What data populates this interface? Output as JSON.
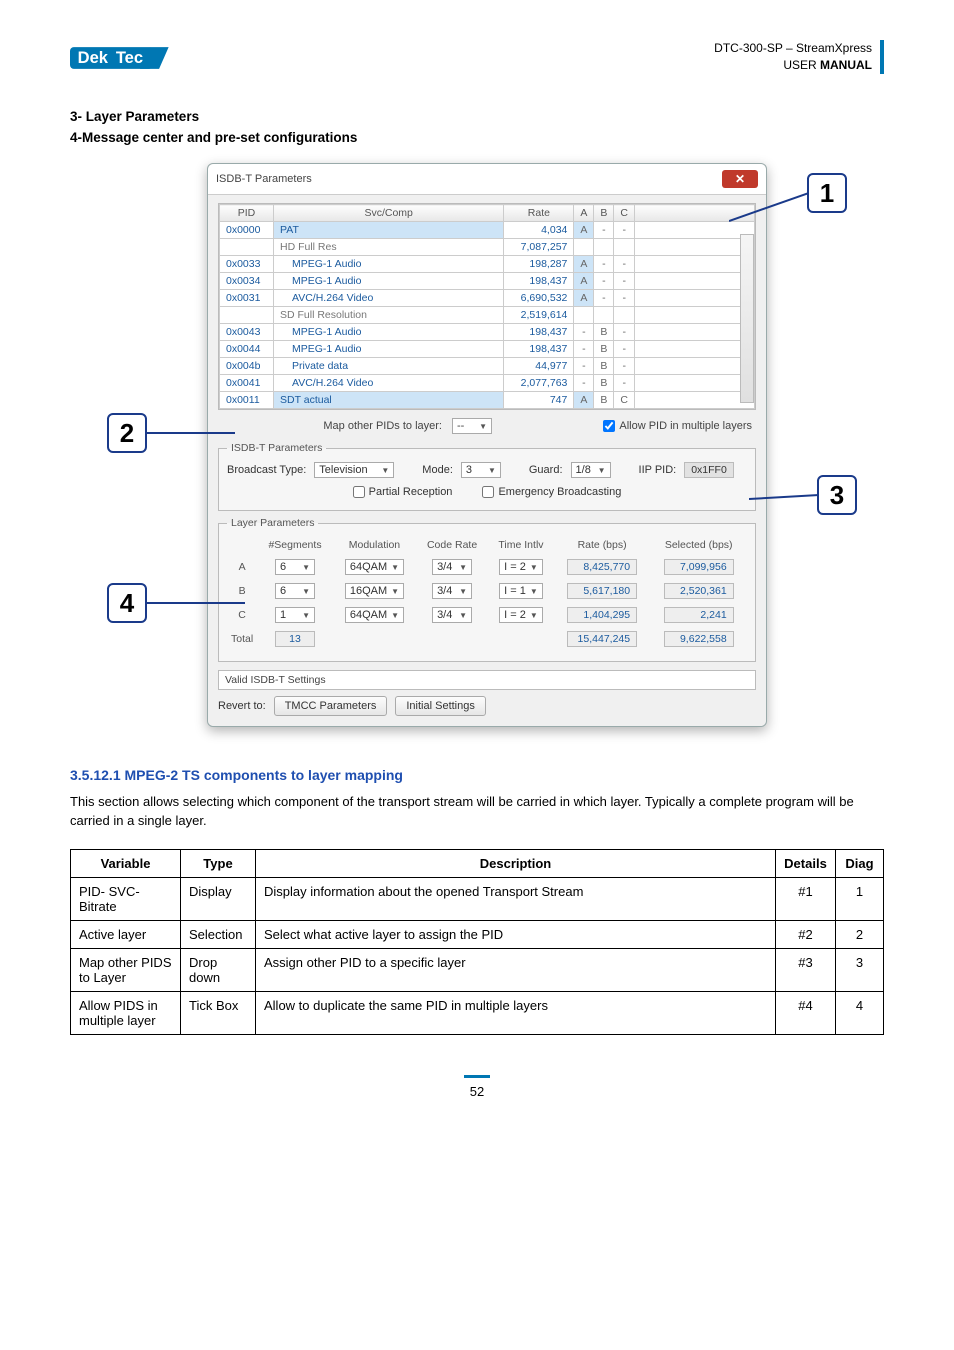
{
  "header": {
    "logo_text": "DekTec",
    "doc_code": "DTC-300-SP – StreamXpress",
    "doc_type_prefix": "USER ",
    "doc_type_bold": "MANUAL"
  },
  "headings": {
    "h3": "3- Layer Parameters",
    "h4": "4-Message center and pre-set configurations"
  },
  "callouts": {
    "c1": "1",
    "c2": "2",
    "c3": "3",
    "c4": "4"
  },
  "dialog": {
    "title": "ISDB-T Parameters",
    "close": "✕",
    "columns": {
      "pid": "PID",
      "svc": "Svc/Comp",
      "rate": "Rate",
      "a": "A",
      "b": "B",
      "c": "C"
    },
    "rows": [
      {
        "pid": "0x0000",
        "name": "PAT",
        "indent": false,
        "rate": "4,034",
        "a": "A",
        "b": "-",
        "c": "-",
        "sel": true
      },
      {
        "pid": "",
        "name": "HD Full Res",
        "indent": false,
        "rate": "7,087,257",
        "a": "",
        "b": "",
        "c": "",
        "group": true
      },
      {
        "pid": "0x0033",
        "name": "MPEG-1 Audio",
        "indent": true,
        "rate": "198,287",
        "a": "A",
        "b": "-",
        "c": "-"
      },
      {
        "pid": "0x0034",
        "name": "MPEG-1 Audio",
        "indent": true,
        "rate": "198,437",
        "a": "A",
        "b": "-",
        "c": "-"
      },
      {
        "pid": "0x0031",
        "name": "AVC/H.264 Video",
        "indent": true,
        "rate": "6,690,532",
        "a": "A",
        "b": "-",
        "c": "-"
      },
      {
        "pid": "",
        "name": "SD Full Resolution",
        "indent": false,
        "rate": "2,519,614",
        "a": "",
        "b": "",
        "c": "",
        "group": true
      },
      {
        "pid": "0x0043",
        "name": "MPEG-1 Audio",
        "indent": true,
        "rate": "198,437",
        "a": "-",
        "b": "B",
        "c": "-"
      },
      {
        "pid": "0x0044",
        "name": "MPEG-1 Audio",
        "indent": true,
        "rate": "198,437",
        "a": "-",
        "b": "B",
        "c": "-"
      },
      {
        "pid": "0x004b",
        "name": "Private data",
        "indent": true,
        "rate": "44,977",
        "a": "-",
        "b": "B",
        "c": "-"
      },
      {
        "pid": "0x0041",
        "name": "AVC/H.264 Video",
        "indent": true,
        "rate": "2,077,763",
        "a": "-",
        "b": "B",
        "c": "-"
      },
      {
        "pid": "0x0011",
        "name": "SDT actual",
        "indent": false,
        "rate": "747",
        "a": "A",
        "b": "B",
        "c": "C",
        "sel": true
      }
    ],
    "map_other_label": "Map other PIDs to layer:",
    "map_other_value": "--",
    "allow_multi_label": "Allow PID in multiple layers",
    "isdbt_fieldset": "ISDB-T Parameters",
    "broadcast_label": "Broadcast Type:",
    "broadcast_value": "Television",
    "mode_label": "Mode:",
    "mode_value": "3",
    "guard_label": "Guard:",
    "guard_value": "1/8",
    "iip_label": "IIP PID:",
    "iip_value": "0x1FF0",
    "partial_label": "Partial Reception",
    "emergency_label": "Emergency Broadcasting",
    "layer_fieldset": "Layer Parameters",
    "layer_headers": {
      "seg": "#Segments",
      "mod": "Modulation",
      "code": "Code Rate",
      "time": "Time Intlv",
      "rate": "Rate (bps)",
      "sel": "Selected (bps)"
    },
    "layers": {
      "A": {
        "seg": "6",
        "mod": "64QAM",
        "code": "3/4",
        "time": "I = 2",
        "rate": "8,425,770",
        "sel": "7,099,956"
      },
      "B": {
        "seg": "6",
        "mod": "16QAM",
        "code": "3/4",
        "time": "I = 1",
        "rate": "5,617,180",
        "sel": "2,520,361"
      },
      "C": {
        "seg": "1",
        "mod": "64QAM",
        "code": "3/4",
        "time": "I = 2",
        "rate": "1,404,295",
        "sel": "2,241"
      }
    },
    "total_label": "Total",
    "total_seg": "13",
    "total_rate": "15,447,245",
    "total_sel": "9,622,558",
    "status": "Valid ISDB-T Settings",
    "revert_label": "Revert to:",
    "btn_tmcc": "TMCC Parameters",
    "btn_initial": "Initial Settings"
  },
  "section": {
    "title": "3.5.12.1 MPEG-2 TS components to layer mapping",
    "para": "This section allows selecting which component of the transport stream will be carried in which layer. Typically a complete program will be carried in a single layer."
  },
  "table": {
    "headers": {
      "var": "Variable",
      "type": "Type",
      "desc": "Description",
      "details": "Details",
      "diag": "Diag"
    },
    "rows": [
      {
        "var": "PID- SVC- Bitrate",
        "type": "Display",
        "desc": "Display information about the opened Transport Stream",
        "details": "#1",
        "diag": "1"
      },
      {
        "var": "Active layer",
        "type": "Selection",
        "desc": "Select what active layer to assign the PID",
        "details": "#2",
        "diag": "2"
      },
      {
        "var": "Map other PIDS to Layer",
        "type": "Drop down",
        "desc": "Assign other PID to a specific layer",
        "details": "#3",
        "diag": "3"
      },
      {
        "var": "Allow PIDS in multiple layer",
        "type": "Tick Box",
        "desc": "Allow to duplicate the same PID in multiple layers",
        "details": "#4",
        "diag": "4"
      }
    ]
  },
  "page": "52"
}
